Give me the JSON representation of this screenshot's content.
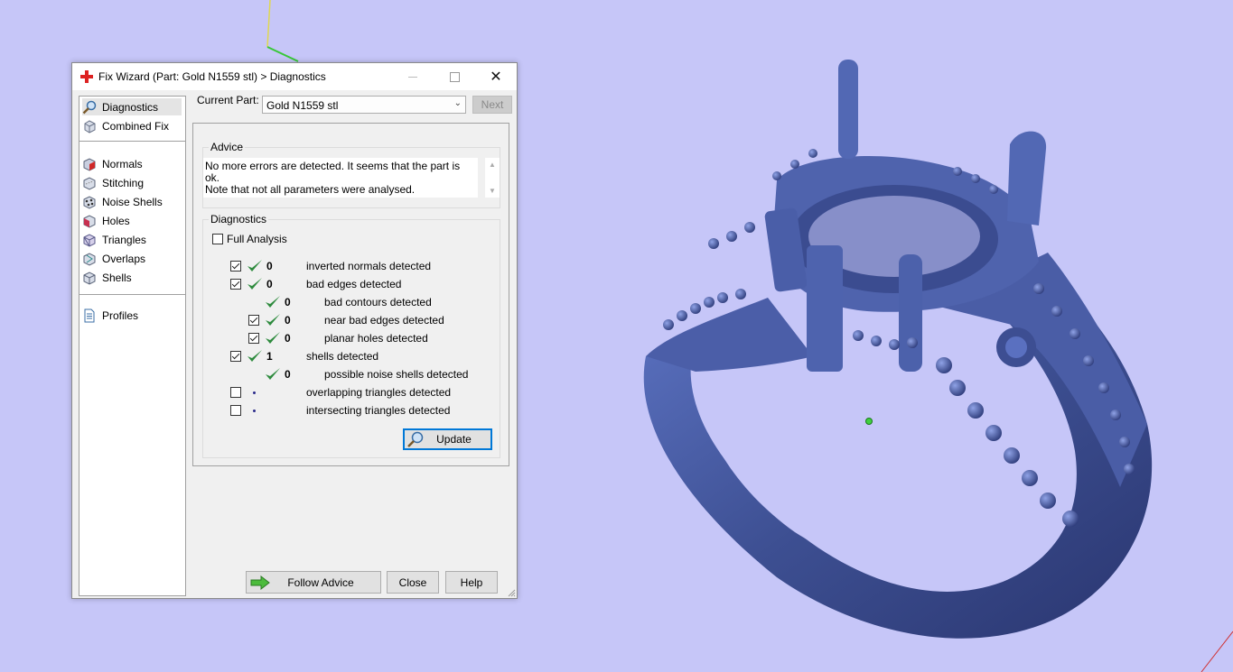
{
  "window": {
    "title": "Fix Wizard (Part: Gold N1559 stl) > Diagnostics"
  },
  "nav": {
    "items": [
      {
        "label": "Diagnostics",
        "icon": "magnifier-icon",
        "selected": true
      },
      {
        "label": "Combined Fix",
        "icon": "cube-icon"
      },
      {
        "label": "Normals",
        "icon": "normals-cube-icon"
      },
      {
        "label": "Stitching",
        "icon": "stitching-cube-icon"
      },
      {
        "label": "Noise Shells",
        "icon": "noise-shells-icon"
      },
      {
        "label": "Holes",
        "icon": "holes-cube-icon"
      },
      {
        "label": "Triangles",
        "icon": "triangles-cube-icon"
      },
      {
        "label": "Overlaps",
        "icon": "overlaps-cube-icon"
      },
      {
        "label": "Shells",
        "icon": "shells-cube-icon"
      },
      {
        "label": "Profiles",
        "icon": "document-icon"
      }
    ]
  },
  "current_part": {
    "label": "Current Part:",
    "value": "Gold N1559 stl",
    "next_label": "Next"
  },
  "advice": {
    "title": "Advice",
    "line1": "No more errors are detected. It seems that the part is ok.",
    "line2": "Note that not all parameters were analysed."
  },
  "diagnostics": {
    "title": "Diagnostics",
    "full_analysis_label": "Full Analysis",
    "full_analysis_checked": false,
    "rows": [
      {
        "checked": true,
        "status": "ok",
        "count": "0",
        "label": "inverted normals detected"
      },
      {
        "checked": true,
        "status": "ok",
        "count": "0",
        "label": "bad edges detected"
      },
      {
        "checked": null,
        "status": "ok",
        "count": "0",
        "label": "bad contours detected"
      },
      {
        "checked": true,
        "status": "ok",
        "count": "0",
        "label": "near bad edges detected"
      },
      {
        "checked": true,
        "status": "ok",
        "count": "0",
        "label": "planar holes detected"
      },
      {
        "checked": true,
        "status": "ok",
        "count": "1",
        "label": "shells detected"
      },
      {
        "checked": null,
        "status": "ok",
        "count": "0",
        "label": "possible noise shells detected"
      },
      {
        "checked": false,
        "status": "not-run",
        "count": "",
        "label": "overlapping triangles detected"
      },
      {
        "checked": false,
        "status": "not-run",
        "count": "",
        "label": "intersecting triangles detected"
      }
    ],
    "update_label": "Update"
  },
  "footer": {
    "follow_advice_label": "Follow Advice",
    "close_label": "Close",
    "help_label": "Help"
  },
  "colors": {
    "viewport_bg": "#c6c6f8",
    "model": "#4a5fa8",
    "check_green": "#2e8b3e",
    "focus_blue": "#0078d7"
  }
}
